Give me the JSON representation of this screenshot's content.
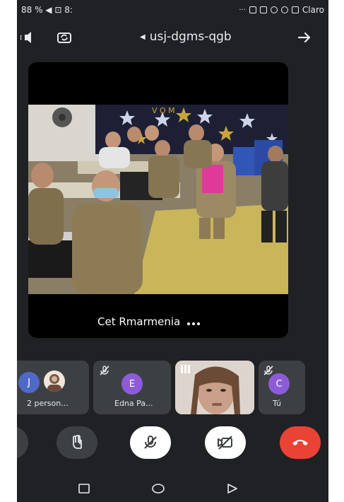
{
  "status_bar": {
    "left_text": "88 % ◀ ⊡ 8:",
    "carrier": "Claro"
  },
  "meeting": {
    "code": "usj-dgms-qgb"
  },
  "main_speaker": {
    "name": "Cet Rmarmenia"
  },
  "participants": [
    {
      "initial": "C",
      "name": "Tú",
      "muted": true,
      "avatar_color": "#8e5bd8"
    },
    {
      "initial": "",
      "name": "",
      "muted": false,
      "is_video": true
    },
    {
      "initial": "E",
      "name": "Edna Pa...",
      "muted": true,
      "avatar_color": "#8e5bd8"
    },
    {
      "initial": "J",
      "name": "2 person...",
      "muted": false,
      "avatar_color": "#4f69c6"
    }
  ],
  "controls": {
    "end_call_color": "#ea4335",
    "camera_state": "off",
    "mic_state": "off"
  },
  "icons": {
    "back": "arrow-icon",
    "switch_camera": "camera-switch-icon",
    "audio_output": "speaker-icon",
    "raise_hand": "hand-icon"
  }
}
